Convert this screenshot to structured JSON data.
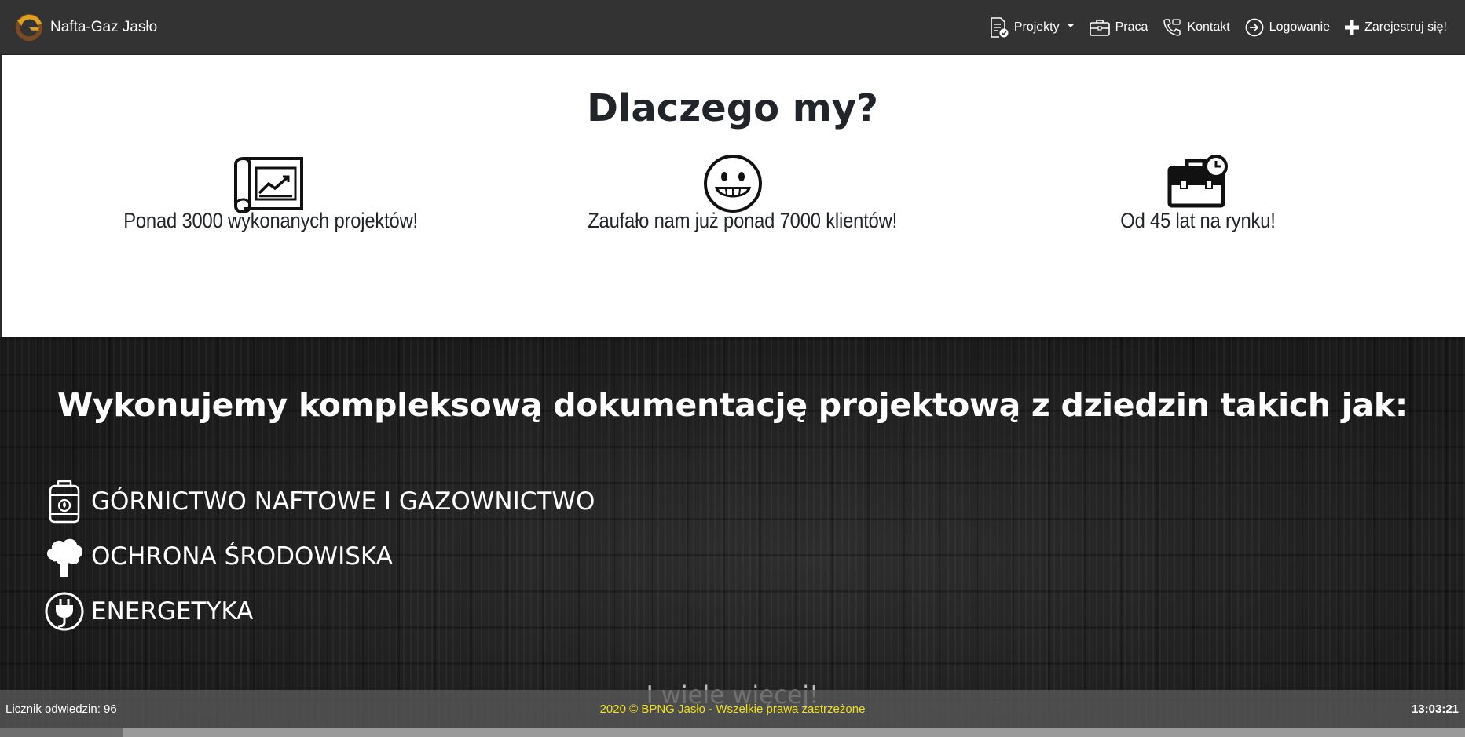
{
  "navbar": {
    "brand": "Nafta-Gaz Jasło",
    "brand_logo_icon": "brand-logo-icon",
    "items": [
      {
        "label": "Projekty",
        "icon": "document-check-icon",
        "dropdown": true
      },
      {
        "label": "Praca",
        "icon": "briefcase-icon"
      },
      {
        "label": "Kontakt",
        "icon": "phone-icon"
      },
      {
        "label": "Logowanie",
        "icon": "login-icon"
      },
      {
        "label": "Zarejestruj się!",
        "icon": "plus-icon"
      }
    ]
  },
  "why": {
    "title": "Dlaczego my?",
    "features": [
      {
        "icon": "blueprint-chart-icon",
        "text": "Ponad 3000 wykonanych projektów!"
      },
      {
        "icon": "smiley-icon",
        "text": "Zaufało nam już ponad 7000 klientów!"
      },
      {
        "icon": "briefcase-clock-icon",
        "text": "Od 45 lat na rynku!"
      }
    ]
  },
  "domains": {
    "title": "Wykonujemy kompleksową dokumentację projektową z dziedzin takich jak:",
    "items": [
      {
        "icon": "gas-cylinder-icon",
        "label": "GÓRNICTWO NAFTOWE I GAZOWNICTWO"
      },
      {
        "icon": "tree-icon",
        "label": "OCHRONA ŚRODOWISKA"
      },
      {
        "icon": "plug-icon",
        "label": "ENERGETYKA"
      }
    ],
    "more": "I wiele więcej!"
  },
  "footer": {
    "visit_counter": "Licznik odwiedzin: 96",
    "copyright": "2020 © BPNG Jasło - Wszelkie prawa zastrzeżone",
    "clock": "13:03:21"
  },
  "colors": {
    "navbar_bg": "#333333",
    "footer_copyright": "#f0e020",
    "logo_accent": "#e0a020"
  }
}
